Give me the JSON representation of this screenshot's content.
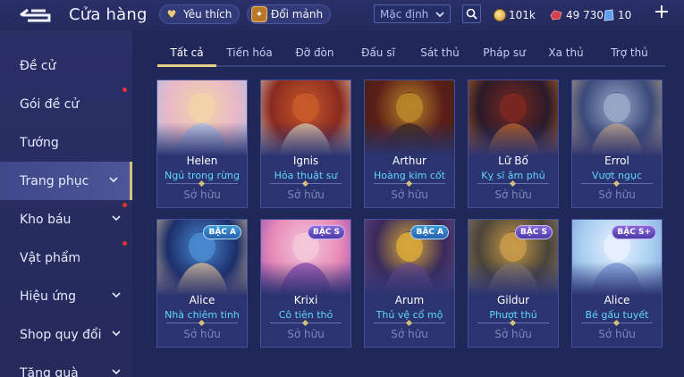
{
  "header": {
    "title": "Cửa hàng",
    "favorites_label": "Yêu thích",
    "fragments_label": "Đổi mảnh",
    "sort": {
      "selected": "Mặc định"
    },
    "currencies": [
      {
        "name": "gold",
        "value": "101k",
        "color": "#d8b24a"
      },
      {
        "name": "ruby",
        "value": "49 730",
        "color": "#d2404c"
      },
      {
        "name": "voucher",
        "value": "10",
        "color": "#7ab8ff"
      }
    ]
  },
  "sidebar": {
    "items": [
      {
        "label": "Đề cử",
        "has_chevron": false,
        "red_dot": false
      },
      {
        "label": "Gói đề cử",
        "has_chevron": false,
        "red_dot": true
      },
      {
        "label": "Tướng",
        "has_chevron": false,
        "red_dot": false
      },
      {
        "label": "Trang phục",
        "has_chevron": true,
        "red_dot": false,
        "active": true
      },
      {
        "label": "Kho báu",
        "has_chevron": true,
        "red_dot": true
      },
      {
        "label": "Vật phẩm",
        "has_chevron": false,
        "red_dot": true
      },
      {
        "label": "Hiệu ứng",
        "has_chevron": true,
        "red_dot": false
      },
      {
        "label": "Shop quy đổi",
        "has_chevron": true,
        "red_dot": false
      },
      {
        "label": "Tặng quà",
        "has_chevron": true,
        "red_dot": false
      }
    ]
  },
  "tabs": [
    "Tất cả",
    "Tiến hóa",
    "Đỡ đòn",
    "Đấu sĩ",
    "Sát thủ",
    "Pháp sư",
    "Xa thủ",
    "Trợ thủ"
  ],
  "active_tab": "Tất cả",
  "cards": [
    {
      "hero": "Helen",
      "skin": "Ngủ trong rừng",
      "status": "Sở hữu",
      "badge": "",
      "palette": [
        "#e8b8c8",
        "#f2d4a8",
        "#a8c0e8"
      ]
    },
    {
      "hero": "Ignis",
      "skin": "Hỏa thuật sư",
      "status": "Sở hữu",
      "badge": "",
      "palette": [
        "#8a2a20",
        "#c85a2a",
        "#e0d0b8"
      ]
    },
    {
      "hero": "Arthur",
      "skin": "Hoàng kim cốt",
      "status": "Sở hữu",
      "badge": "",
      "palette": [
        "#5a1e18",
        "#b8862a",
        "#3a2418"
      ]
    },
    {
      "hero": "Lữ Bố",
      "skin": "Kỵ sĩ âm phủ",
      "status": "Sở hữu",
      "badge": "",
      "palette": [
        "#2a1a28",
        "#7a2820",
        "#c06a2a"
      ]
    },
    {
      "hero": "Errol",
      "skin": "Vượt ngục",
      "status": "Sở hữu",
      "badge": "",
      "palette": [
        "#3a4a7a",
        "#9aa8c8",
        "#c8a888"
      ]
    },
    {
      "hero": "Alice",
      "skin": "Nhà chiêm tinh",
      "status": "Sở hữu",
      "badge": "BẬC A",
      "badge_class": "a",
      "palette": [
        "#1c2e6a",
        "#4a8ad0",
        "#e8c89a"
      ]
    },
    {
      "hero": "Krixi",
      "skin": "Cô tiên thỏ",
      "status": "Sở hữu",
      "badge": "BẬC S",
      "badge_class": "s",
      "palette": [
        "#e88ab8",
        "#f4c8d8",
        "#8a4ab0"
      ]
    },
    {
      "hero": "Arum",
      "skin": "Thủ vệ cổ mộ",
      "status": "Sở hữu",
      "badge": "BẬC A",
      "badge_class": "a",
      "palette": [
        "#3a2a5a",
        "#d8a83a",
        "#6a4a88"
      ]
    },
    {
      "hero": "Gildur",
      "skin": "Phượt thủ",
      "status": "Sở hữu",
      "badge": "BẬC S",
      "badge_class": "s",
      "palette": [
        "#4a4438",
        "#c89a4a",
        "#8a7a6a"
      ]
    },
    {
      "hero": "Alice",
      "skin": "Bé gấu tuyết",
      "status": "Sở hữu",
      "badge": "BẬC S+",
      "badge_class": "s",
      "palette": [
        "#a8d0f0",
        "#e8f0ff",
        "#7a9ad8"
      ]
    }
  ]
}
